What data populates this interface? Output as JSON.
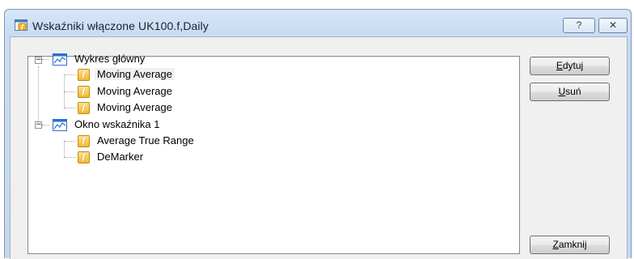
{
  "window": {
    "title": "Wskaźniki włączone UK100.f,Daily",
    "help_label": "?",
    "close_label": "✕"
  },
  "tree": {
    "groups": [
      {
        "label": "Wykres główny",
        "expander": "−",
        "items": [
          {
            "label": "Moving Average",
            "selected": true
          },
          {
            "label": "Moving Average",
            "selected": false
          },
          {
            "label": "Moving Average",
            "selected": false
          }
        ]
      },
      {
        "label": "Okno wskaźnika 1",
        "expander": "−",
        "items": [
          {
            "label": "Average True Range",
            "selected": false
          },
          {
            "label": "DeMarker",
            "selected": false
          }
        ]
      }
    ]
  },
  "buttons": {
    "edit": {
      "mnemonic": "E",
      "rest": "dytuj"
    },
    "delete": {
      "mnemonic": "U",
      "rest": "suń"
    },
    "close": {
      "mnemonic": "Z",
      "rest": "amknij"
    }
  },
  "icons": {
    "indicator_glyph": "f",
    "chart_color": "#2a6fd0",
    "indicator_color": "#f2b82d"
  }
}
